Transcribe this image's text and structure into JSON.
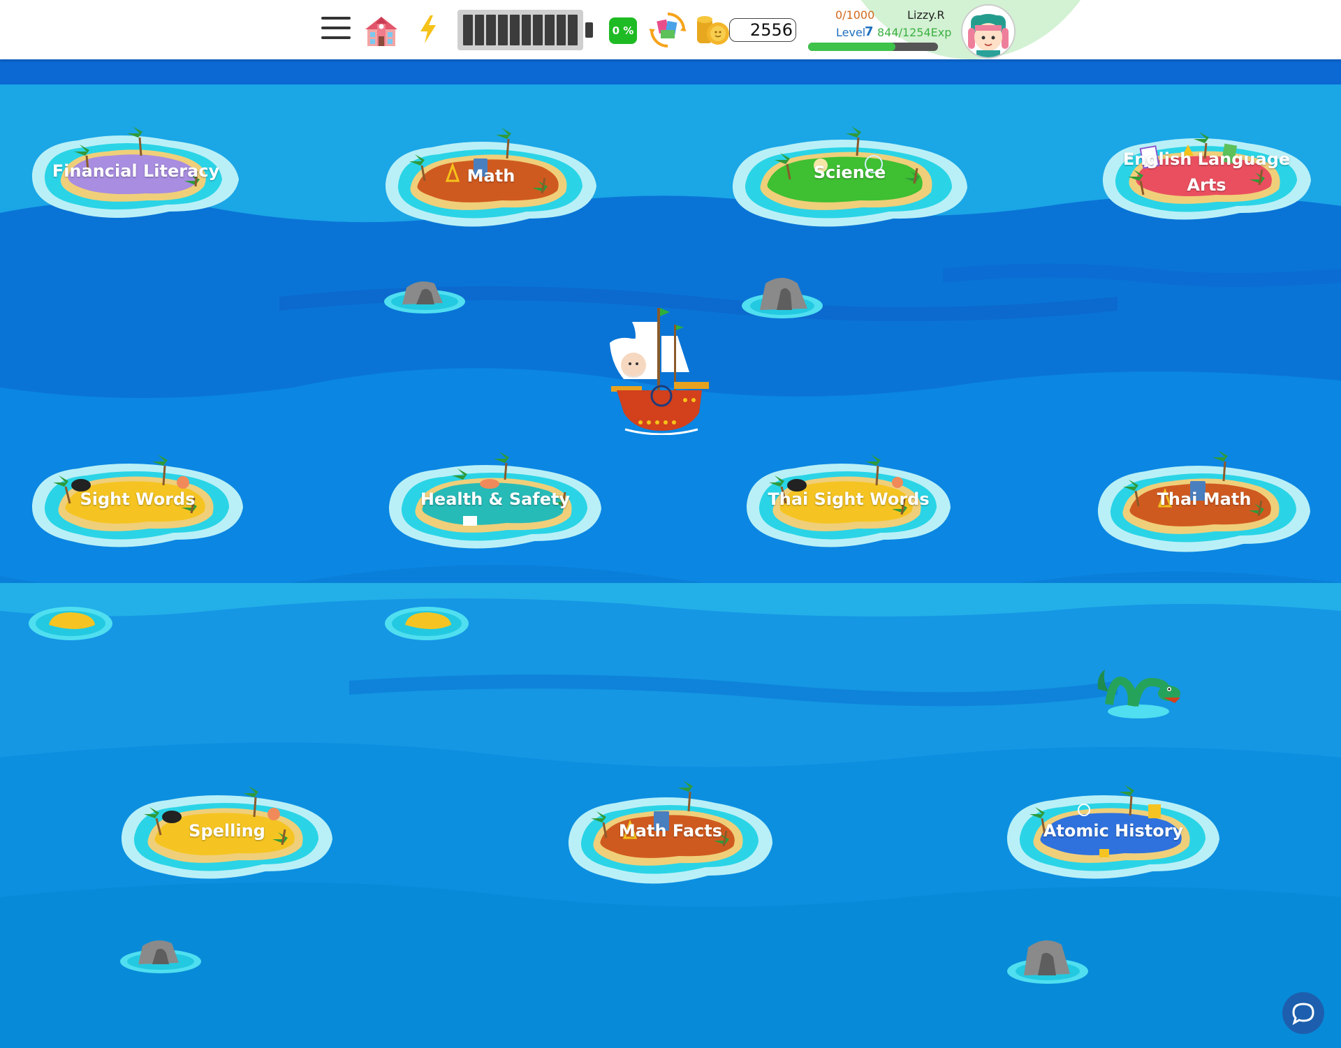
{
  "topbar": {
    "menu_icon": "hamburger-menu-icon",
    "home_icon": "school-house-icon",
    "energy_icon": "lightning-bolt-icon",
    "progress_badge": "0 %",
    "books_icon": "books-cycle-icon",
    "coins_icon": "gold-coins-icon",
    "coin_count": "2556",
    "goal": "0/1000",
    "username": "Lizzy.R",
    "level_label": "Level",
    "level_value": "7",
    "exp_text": "844/1254Exp",
    "exp_progress": 0.67,
    "avatar_icon": "girl-avatar-icon"
  },
  "islands": [
    {
      "label": "Financial Literacy"
    },
    {
      "label": "Math"
    },
    {
      "label": "Science"
    },
    {
      "label": "English Language Arts"
    },
    {
      "label": "Sight Words"
    },
    {
      "label": "Health & Safety"
    },
    {
      "label": "Thai Sight Words"
    },
    {
      "label": "Thai Math"
    },
    {
      "label": "Spelling"
    },
    {
      "label": "Math Facts"
    },
    {
      "label": "Atomic History"
    }
  ],
  "colors": {
    "ocean": "#0a7fd9",
    "financial": "#a88de0",
    "math": "#cf5a1f",
    "science": "#3fbf32",
    "english": "#ea4f5f",
    "yellow_island": "#f5c422",
    "health": "#27bbb8",
    "atomic": "#2f72de",
    "sand": "#f0cf7a",
    "lagoon": "#2ad4e6",
    "progress_green": "#1fbb24"
  },
  "chat_icon": "chat-bubble-icon"
}
